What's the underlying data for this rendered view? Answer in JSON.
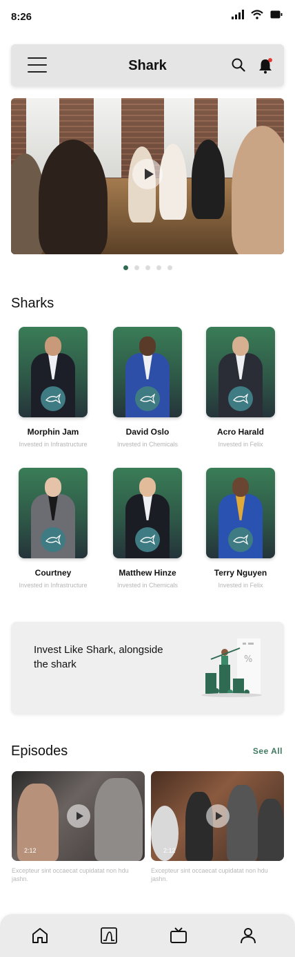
{
  "status": {
    "time": "8:26"
  },
  "header": {
    "title": "Shark"
  },
  "carousel": {
    "dots": [
      true,
      false,
      false,
      false,
      false
    ]
  },
  "sharks_section": {
    "title": "Sharks"
  },
  "sharks": [
    {
      "name": "Morphin Jam",
      "subtitle": "Invested in Infrastructure"
    },
    {
      "name": "David Oslo",
      "subtitle": "Invested in Chemicals"
    },
    {
      "name": "Acro Harald",
      "subtitle": "Invested in Felix"
    },
    {
      "name": "Courtney",
      "subtitle": "Invested in Infrastructure"
    },
    {
      "name": "Matthew Hinze",
      "subtitle": "Invested in Chemicals"
    },
    {
      "name": "Terry Nguyen",
      "subtitle": "Invested in Felix"
    }
  ],
  "promo": {
    "text": "Invest Like Shark, alongside the shark"
  },
  "episodes_section": {
    "title": "Episodes",
    "see_all": "See All"
  },
  "episodes": [
    {
      "duration": "2:12",
      "description": "Excepteur sint occaecat cupidatat non hdu jashn."
    },
    {
      "duration": "2:12",
      "description": "Excepteur sint occaecat cupidatat non hdu jashn."
    }
  ],
  "icons": {
    "status": [
      "signal-icon",
      "wifi-icon",
      "battery-icon"
    ],
    "header": [
      "menu-icon",
      "search-icon",
      "bell-icon"
    ],
    "nav": [
      "home-icon",
      "chart-icon",
      "tv-icon",
      "profile-icon"
    ]
  },
  "colors": {
    "accent": "#2f6a52",
    "notification": "#e53935",
    "card_bg": "#efefef"
  }
}
